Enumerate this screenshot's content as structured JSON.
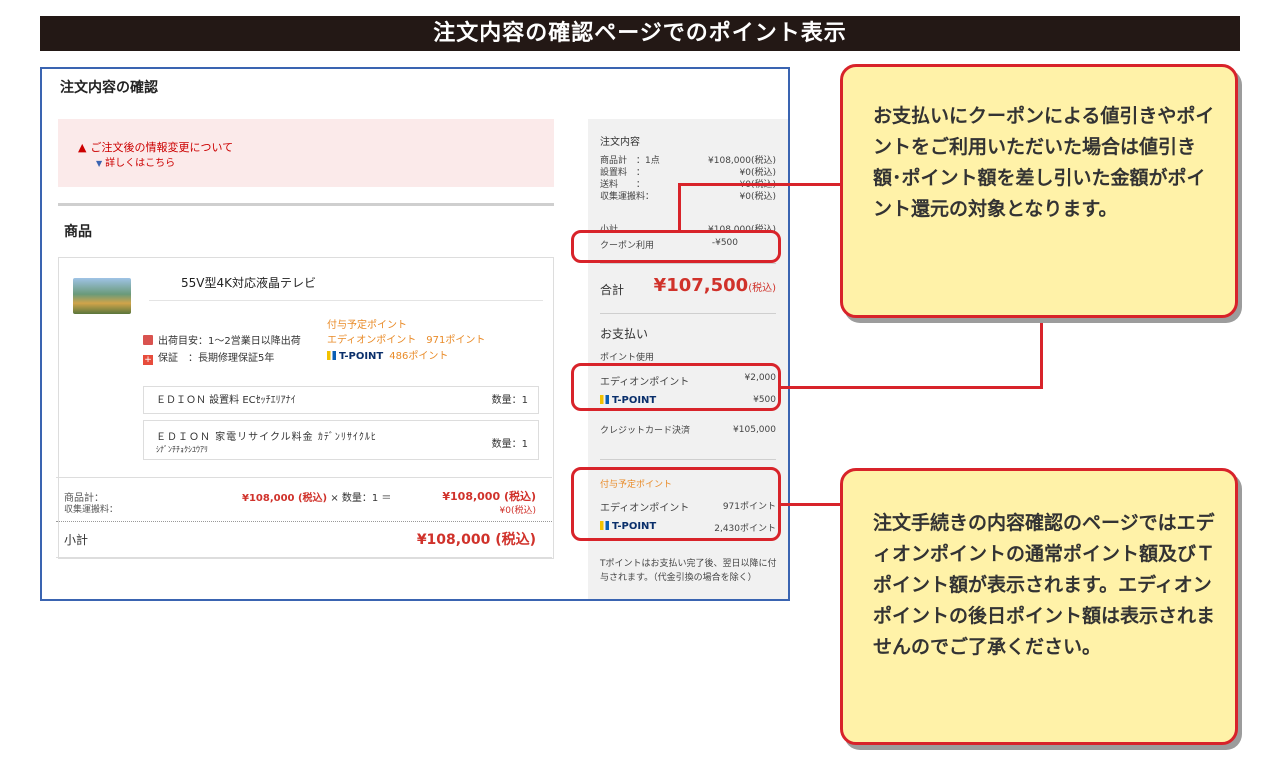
{
  "banner": {
    "title": "注文内容の確認ページでのポイント表示"
  },
  "page": {
    "title": "注文内容の確認"
  },
  "notice": {
    "text": "ご注文後の情報変更について",
    "link": "詳しくはこちら"
  },
  "section": {
    "title": "商品"
  },
  "product": {
    "name": "55V型4K対応液晶テレビ",
    "ship": "出荷目安：1～2営業日以降出荷",
    "warranty": "保証　：長期修理保証5年",
    "points_head": "付与予定ポイント",
    "edion_points": "エディオンポイント　971ポイント",
    "tpoint_label": "T-POINT",
    "tpoint_value": "486ポイント"
  },
  "services": [
    {
      "name": "ＥＤＩＯＮ 設置料 ECｾｯﾁｴﾘｱﾅｲ",
      "qty": "数量：1"
    },
    {
      "name": "ＥＤＩＯＮ 家電リサイクル料金 ｶﾃﾞﾝﾘｻｲｸﾙﾋ",
      "name2": "ｼﾅﾞﾝﾁﾁｮｸｼﾕｳｱﾘ",
      "qty": "数量：1"
    }
  ],
  "totals": {
    "subtotal_label": "商品計：",
    "collect_label": "収集運搬料：",
    "calc_price": "¥108,000 (税込)",
    "calc_rest": " × 数量：1 ＝",
    "subtotal_value": "¥108,000 (税込)",
    "collect_value": "¥0(税込)",
    "sum_label": "小計",
    "sum_value": "¥108,000 (税込)"
  },
  "sidebar": {
    "order_head": "注文内容",
    "rows": [
      {
        "label": "商品計　：1点",
        "value": "¥108,000(税込)"
      },
      {
        "label": "設置料　：",
        "value": "¥0(税込)"
      },
      {
        "label": "送料　　：",
        "value": "¥0(税込)"
      },
      {
        "label": "収集運搬料：",
        "value": "¥0(税込)"
      }
    ],
    "small_label": "小計",
    "small_value": "¥108,000(税込)",
    "coupon_label": "クーポン利用",
    "coupon_value": "-¥500",
    "total_label": "合計",
    "total_value": "¥107,500",
    "total_tax": "(税込)",
    "pay_head": "お支払い",
    "point_use": "ポイント使用",
    "edion_point_label": "エディオンポイント",
    "edion_point_value": "¥2,000",
    "tpoint_label": "T-POINT",
    "tpoint_value": "¥500",
    "credit_label": "クレジットカード決済",
    "credit_value": "¥105,000",
    "grant_head": "付与予定ポイント",
    "grant_edion_label": "エディオンポイント",
    "grant_edion_value": "971ポイント",
    "grant_t_label": "T-POINT",
    "grant_t_value": "2,430ポイント",
    "note": "Tポイントはお支払い完了後、翌日以降に付与されます。（代金引換の場合を除く）"
  },
  "callouts": {
    "top": "お支払いにクーポンによる値引きやポイントをご利用いただいた場合は値引き額･ポイント額を差し引いた金額がポイント還元の対象となります。",
    "bottom": "注文手続きの内容確認のページではエディオンポイントの通常ポイント額及びＴポイント額が表示されます。エディオンポイントの後日ポイント額は表示されませんのでご了承ください。"
  },
  "colors": {
    "accent_red": "#d8232a",
    "callout_bg": "#fff2a8",
    "price_red": "#d0322b",
    "point_orange": "#e98b28",
    "panel_border": "#3a64b1"
  }
}
